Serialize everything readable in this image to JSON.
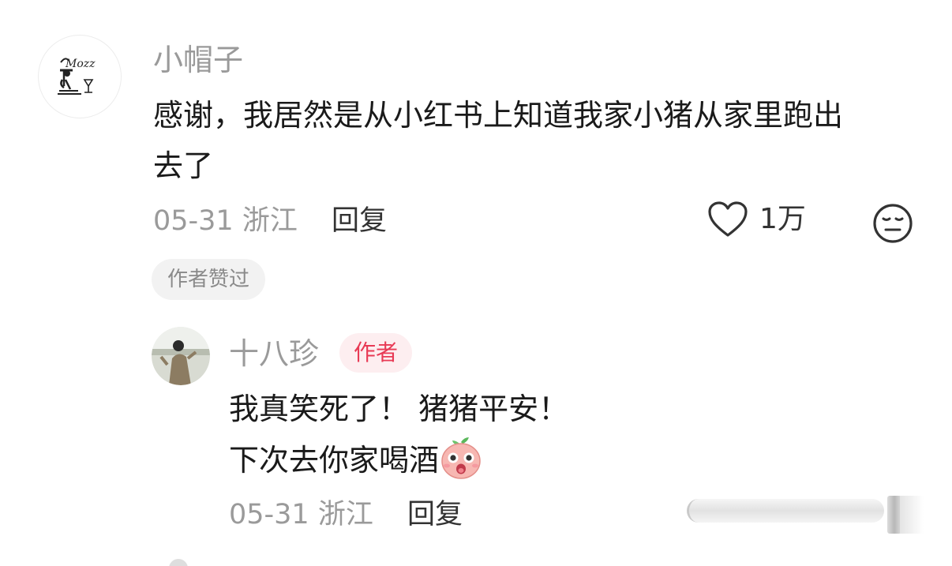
{
  "comment": {
    "username": "小帽子",
    "text_line1": "感谢，我居然是从小红书上知道我家小猪从家里跑出",
    "text_line2": "去了",
    "date": "05-31",
    "location": "浙江",
    "reply_label": "回复",
    "like_count": "1万",
    "author_liked_badge": "作者赞过",
    "avatar_logo_text": "Mozz"
  },
  "reply": {
    "username": "十八珍",
    "author_tag": "作者",
    "text_line1": "我真笑死了！ 猪猪平安！",
    "text_line2": "下次去你家喝酒",
    "date": "05-31",
    "location": "浙江",
    "reply_label": "回复"
  },
  "icons": {
    "like": "heart-outline-icon",
    "face": "neutral-face-icon",
    "emoji": "surprised-peach-emoji"
  },
  "colors": {
    "accent": "#e83a55",
    "tag_bg": "#fdeef0",
    "muted_text": "#9a9a9a"
  }
}
